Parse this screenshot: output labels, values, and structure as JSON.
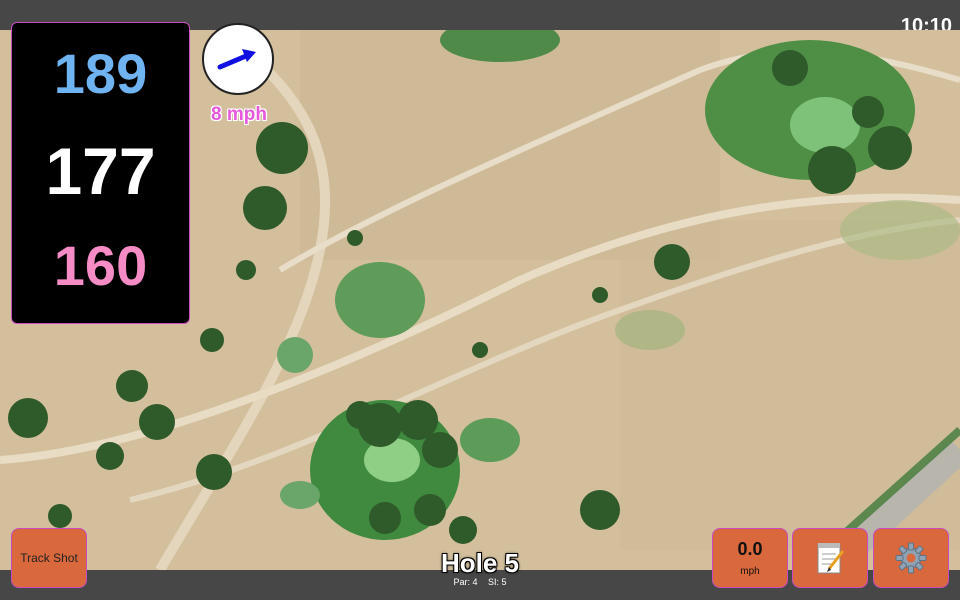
{
  "status_bar": {
    "time": "10:10"
  },
  "distances": {
    "back": "189",
    "middle": "177",
    "front": "160",
    "colors": {
      "back": "#6fb4f0",
      "middle": "#ffffff",
      "front": "#f58cc5"
    }
  },
  "wind": {
    "speed": "8 mph",
    "direction_icon": "arrow-icon"
  },
  "map": {
    "view": "satellite",
    "icon": "aerial-course-map"
  },
  "buttons": {
    "track_shot": "Track Shot",
    "speed_value": "0.0",
    "speed_unit": "mph",
    "notes_icon": "notepad-icon",
    "settings_icon": "gear-icon",
    "accent": "#d9683d"
  },
  "hole": {
    "title": "Hole 5",
    "par": "Par: 4",
    "si": "SI: 5"
  }
}
